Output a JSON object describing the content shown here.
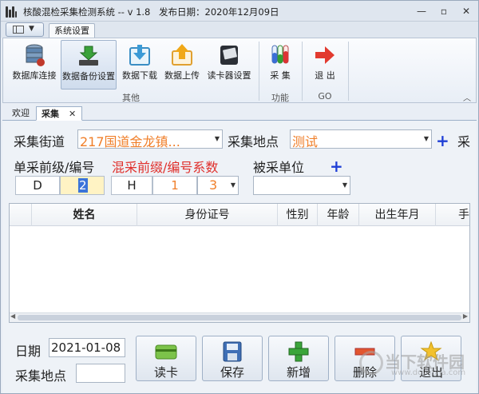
{
  "window": {
    "title": "核酸混检采集检测系统 -- v 1.8",
    "release_date": "发布日期：2020年12月09日",
    "controls": [
      "—",
      "▫",
      "✕"
    ]
  },
  "ribbon": {
    "tab": "系统设置",
    "groups": [
      {
        "label": "其他",
        "buttons": [
          "数据库连接",
          "数据备份设置",
          "数据下载",
          "数据上传",
          "读卡器设置"
        ]
      },
      {
        "label": "功能",
        "buttons": [
          "采 集"
        ]
      },
      {
        "label": "GO",
        "buttons": [
          "退 出"
        ]
      }
    ],
    "active_button": "数据备份设置"
  },
  "doc_tabs": [
    {
      "label": "欢迎",
      "active": false
    },
    {
      "label": "采集",
      "active": true,
      "close": "✕"
    }
  ],
  "form": {
    "street_label": "采集街道",
    "street_value": "217国道金龙镇...",
    "location_label": "采集地点",
    "location_value": "测试",
    "row1_tail": "采",
    "prefix_label": "单采前级/编号",
    "mixed_label": "混采前缀/编号系数",
    "unit_label": "被采单位",
    "single_prefix": "D",
    "single_number": "2",
    "mixed_prefix": "H",
    "mixed_number": "1",
    "mixed_factor": "3",
    "unit_value": ""
  },
  "grid": {
    "columns": [
      "",
      "姓名",
      "身份证号",
      "性别",
      "年龄",
      "出生年月",
      "手"
    ]
  },
  "bottom": {
    "date_label": "日期",
    "date_value": "2021-01-08",
    "location_label": "采集地点",
    "location_value": "",
    "buttons": [
      "读卡",
      "保存",
      "新增",
      "删除",
      "退出"
    ]
  },
  "watermark": {
    "text": "当下软件园",
    "url": "www.downxia.com"
  },
  "colors": {
    "red_label": "#e0302c",
    "orange_value": "#f07f2a",
    "plus_blue": "#1f3fd6"
  }
}
